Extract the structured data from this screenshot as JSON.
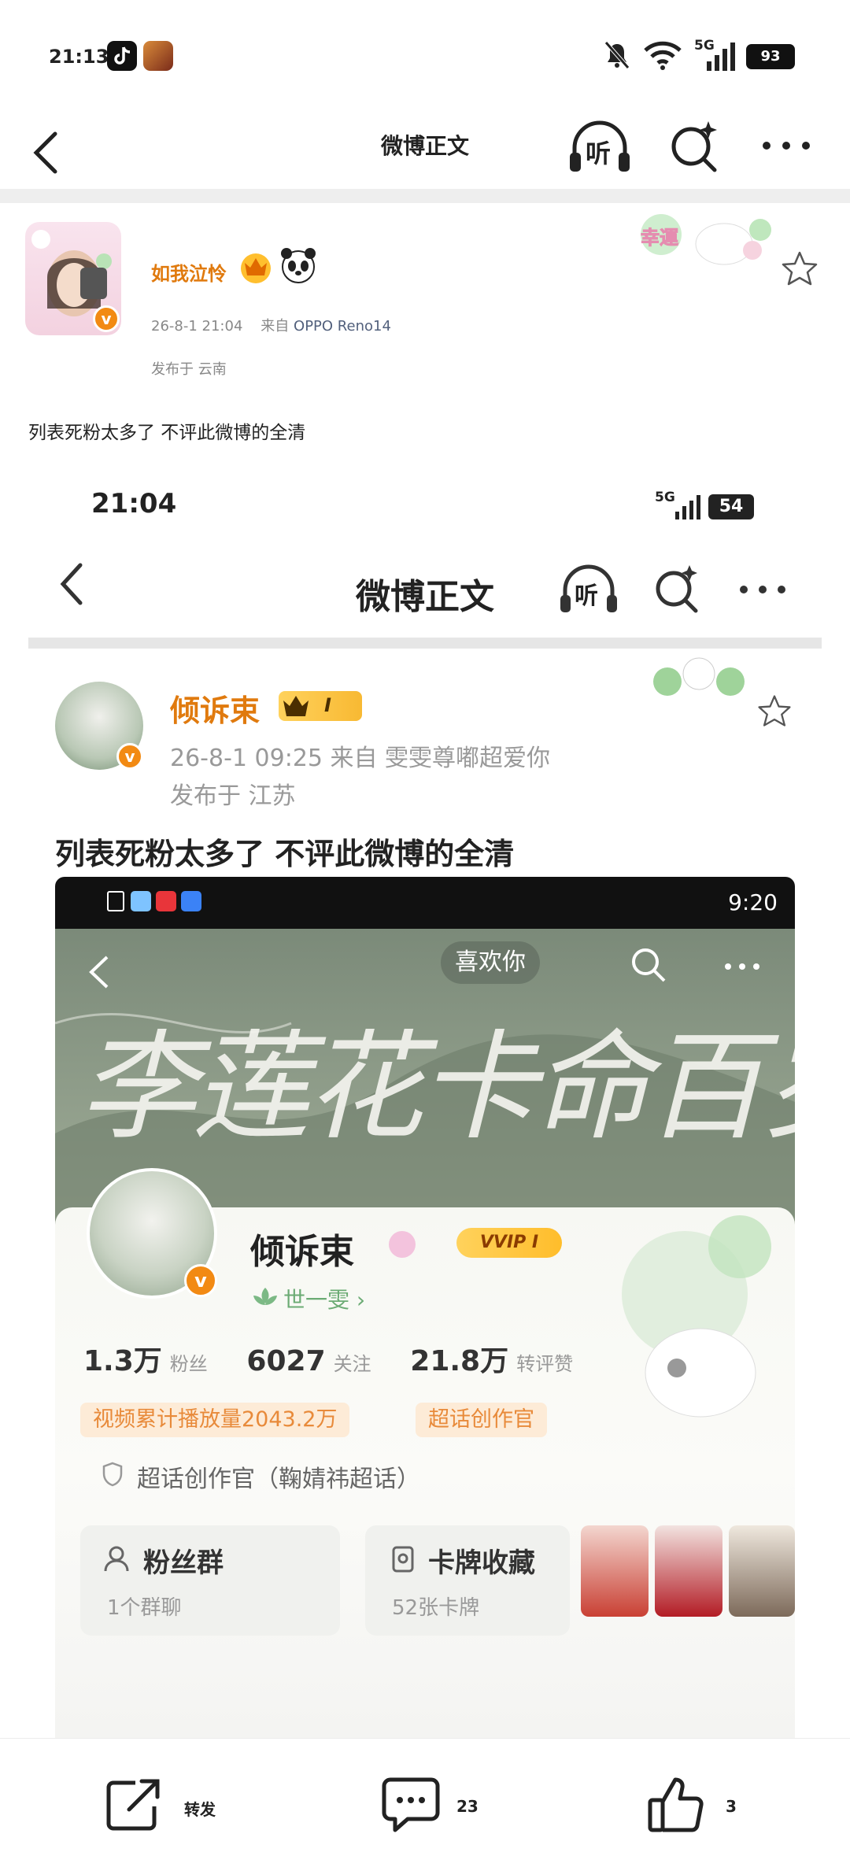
{
  "status": {
    "time": "21:13",
    "battery": "93",
    "network": "5G"
  },
  "nav": {
    "title": "微博正文",
    "listen_label": "听"
  },
  "post": {
    "author": "如我泣怜",
    "date": "26-8-1 21:04",
    "from_prefix": "来自",
    "device": "OPPO Reno14",
    "location": "发布于 云南",
    "text": "列表死粉太多了   不评此微博的全清",
    "decoration_label": "幸運"
  },
  "embedded": {
    "time": "21:04",
    "battery": "54",
    "network": "5G",
    "title": "微博正文",
    "listen_label": "听",
    "author": "倾诉束",
    "badge": "I",
    "meta": "26-8-1 09:25   来自 雯雯尊嘟超爱你",
    "location": "发布于 江苏",
    "text": "列表死粉太多了  不评此微博的全清",
    "inner": {
      "time": "9:20",
      "calligraphy": "李莲花卡命百岁",
      "like_label": "喜欢你",
      "name": "倾诉束",
      "vip": "VVIP I",
      "sub": "世一雯 ›",
      "stats": [
        {
          "value": "1.3万",
          "label": "粉丝"
        },
        {
          "value": "6027",
          "label": "关注"
        },
        {
          "value": "21.8万",
          "label": "转评赞"
        }
      ],
      "tags": [
        "视频累计播放量2043.2万",
        "超话创作官"
      ],
      "topic": "超话创作官（鞠婧祎超话）",
      "fans_group": {
        "title": "粉丝群",
        "sub": "1个群聊"
      },
      "cards": {
        "title": "卡牌收藏",
        "sub": "52张卡牌"
      }
    }
  },
  "bottom": {
    "repost": "转发",
    "comments": "23",
    "likes": "3"
  }
}
